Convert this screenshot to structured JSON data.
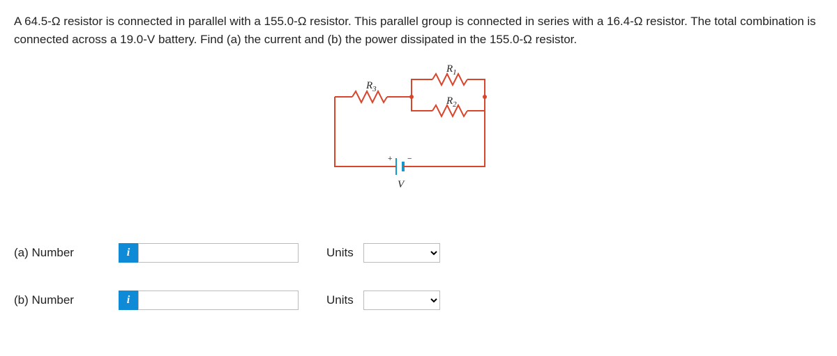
{
  "question": "A 64.5-Ω resistor is connected in parallel with a 155.0-Ω resistor. This parallel group is connected in series with a 16.4-Ω resistor. The total combination is connected across a 19.0-V battery. Find (a) the current and (b) the power dissipated in the 155.0-Ω resistor.",
  "circuit": {
    "R1_label": "R",
    "R1_sub": "1",
    "R2_label": "R",
    "R2_sub": "2",
    "R3_label": "R",
    "R3_sub": "3",
    "V_label": "V",
    "plus": "+",
    "minus": "−"
  },
  "parts": {
    "a": {
      "label": "(a)   Number",
      "units_label": "Units"
    },
    "b": {
      "label": "(b)   Number",
      "units_label": "Units"
    }
  },
  "info_icon": "i"
}
